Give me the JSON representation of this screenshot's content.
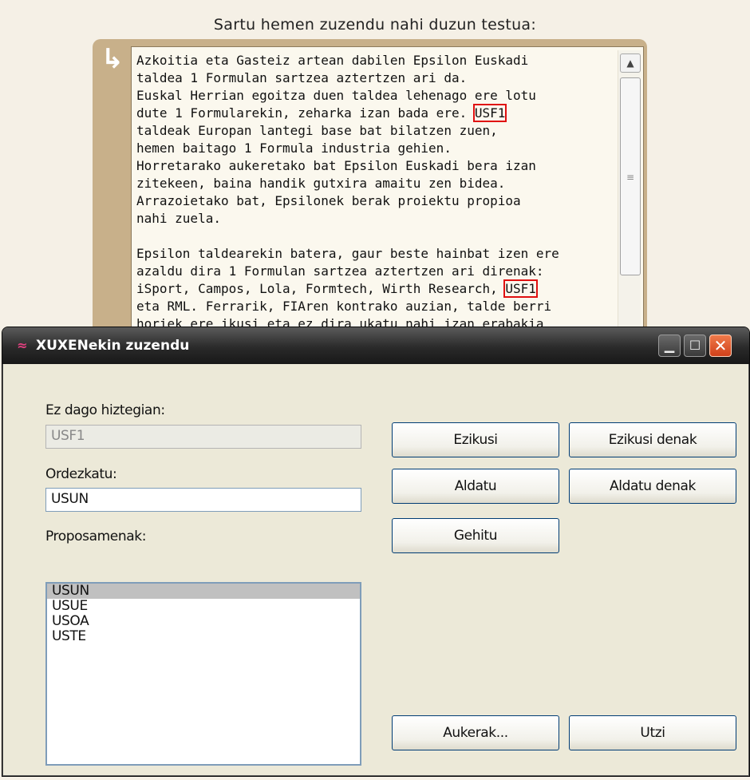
{
  "page": {
    "prompt_label": "Sartu hemen zuzendu nahi duzun testua:",
    "arrow_glyph": "↳"
  },
  "editor": {
    "line1": "Azkoitia eta Gasteiz artean dabilen Epsilon Euskadi",
    "line2": "taldea 1 Formulan sartzea aztertzen ari da.",
    "line3": "Euskal Herrian egoitza duen taldea lehenago ere lotu",
    "line4a": "dute 1 Formularekin, zeharka izan bada ere. ",
    "line4b": "USF1",
    "line5": "taldeak Europan lantegi base bat bilatzen zuen,",
    "line6": "hemen baitago 1 Formula industria gehien.",
    "line7": "Horretarako aukeretako bat Epsilon Euskadi bera izan",
    "line8": "zitekeen, baina handik gutxira amaitu zen bidea.",
    "line9": "Arrazoietako bat, Epsilonek berak proiektu propioa",
    "line10": "nahi zuela.",
    "line11": "Epsilon taldearekin batera, gaur beste hainbat izen ere",
    "line12": "azaldu dira 1 Formulan sartzea aztertzen ari direnak:",
    "line13a": "iSport, Campos, Lola, Formtech, Wirth Research, ",
    "line13b": "USF1",
    "line14": "eta RML. Ferrarik, FIAren kontrako auzian, talde berri",
    "line15": "horiek ere ikusi eta ez dira ukatu nahi izan erabakia"
  },
  "dialog": {
    "title": "XUXENekin zuzendu",
    "minimize_glyph": "▁",
    "maximize_glyph": "☐",
    "close_glyph": "✕",
    "not_in_dict_label": "Ez dago hiztegian:",
    "not_in_dict_value": "USF1",
    "replace_label": "Ordezkatu:",
    "replace_value": "USUN",
    "suggestions_label": "Proposamenak:",
    "suggestions": [
      "USUN",
      "USUE",
      "USOA",
      "USTE"
    ],
    "btn_ignore": "Ezikusi",
    "btn_ignore_all": "Ezikusi denak",
    "btn_change": "Aldatu",
    "btn_change_all": "Aldatu denak",
    "btn_add": "Gehitu",
    "btn_options": "Aukerak...",
    "btn_cancel": "Utzi"
  },
  "colors": {
    "page_bg": "#f5f0e6",
    "frame": "#c8b08a",
    "highlight": "#e01010",
    "titlebar": "#2a2a2a",
    "dialog_bg": "#ece9d8"
  }
}
